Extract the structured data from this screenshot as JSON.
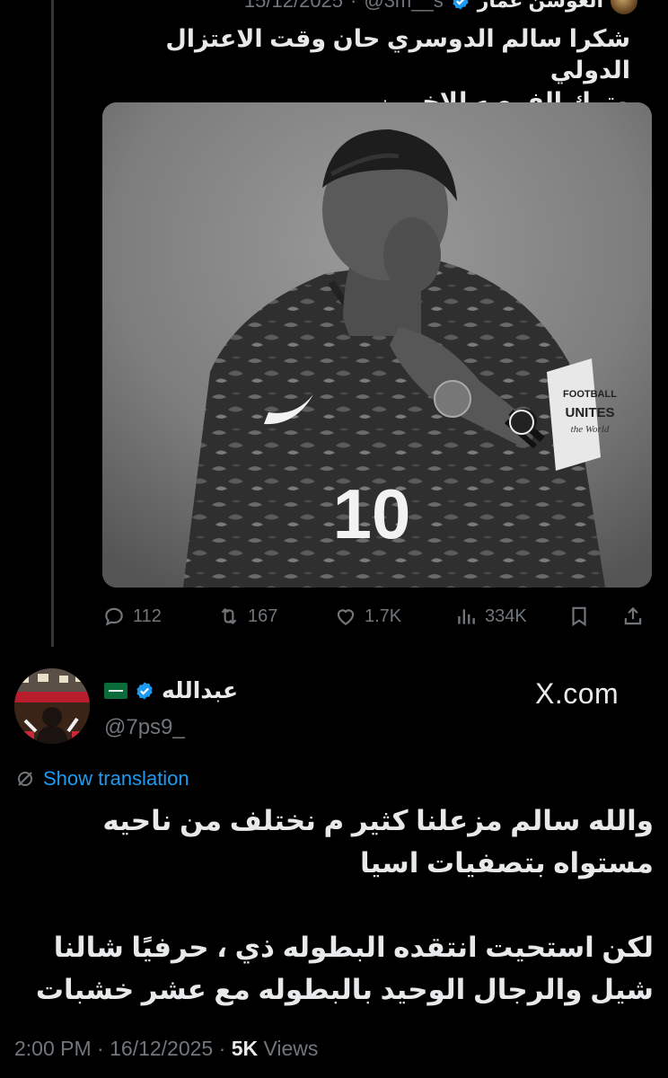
{
  "quoted_tweet": {
    "author_name": "العوشن عمار",
    "author_handle": "@3m__s",
    "date": "15/12/2025",
    "text_line1": "شكرا سالم الدوسري حان وقت الاعتزال الدولي",
    "text_line2": "وترك الفرصه للاخرين",
    "stats": {
      "replies": "112",
      "reposts": "167",
      "likes": "1.7K",
      "views": "334K"
    },
    "photo": {
      "jersey_number": "10",
      "armband_line1": "FOOTBALL",
      "armband_line2": "UNITES",
      "armband_line3": "the World"
    }
  },
  "reply_tweet": {
    "author_name": "عبدالله",
    "author_handle": "@7ps9_",
    "watermark": "X.com",
    "translate_label": "Show translation",
    "paragraph1": "والله سالم مزعلنا كثير م نختلف من ناحيه مستواه بتصفيات اسيا",
    "paragraph2": "لكن استحيت انتقده البطوله ذي ، حرفيًا شالنا شيل والرجال الوحيد بالبطوله مع عشر خشبات",
    "time": "2:00 PM",
    "date": "16/12/2025",
    "views_count": "5K",
    "views_label": "Views"
  },
  "icons": [
    "reply-icon",
    "repost-icon",
    "like-icon",
    "views-icon",
    "bookmark-icon",
    "share-icon",
    "verified-badge-icon",
    "globe-icon"
  ],
  "colors": {
    "background": "#000000",
    "text": "#e7e9ea",
    "muted": "#71767b",
    "link": "#1d9bf0",
    "verified": "#1d9bf0"
  }
}
